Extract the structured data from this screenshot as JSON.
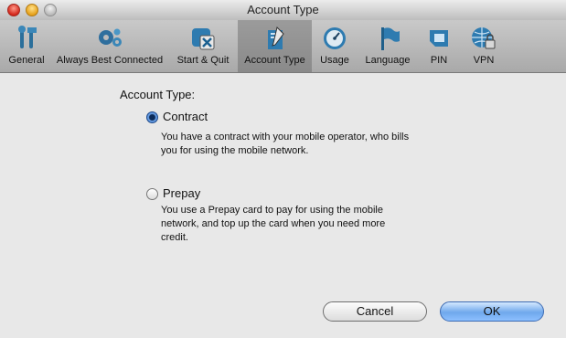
{
  "window": {
    "title": "Account Type"
  },
  "toolbar": {
    "items": [
      {
        "label": "General",
        "icon": "general-icon",
        "selected": false
      },
      {
        "label": "Always Best Connected",
        "icon": "gears-icon",
        "selected": false
      },
      {
        "label": "Start & Quit",
        "icon": "start-quit-icon",
        "selected": false
      },
      {
        "label": "Account Type",
        "icon": "account-type-icon",
        "selected": true
      },
      {
        "label": "Usage",
        "icon": "usage-gauge-icon",
        "selected": false
      },
      {
        "label": "Language",
        "icon": "flag-icon",
        "selected": false
      },
      {
        "label": "PIN",
        "icon": "sim-card-icon",
        "selected": false
      },
      {
        "label": "VPN",
        "icon": "vpn-globe-lock-icon",
        "selected": false
      }
    ]
  },
  "content": {
    "section_label": "Account Type:",
    "options": [
      {
        "label": "Contract",
        "checked": true,
        "description_lines": [
          "You have a contract with your mobile operator, who bills",
          "you for using the mobile network."
        ]
      },
      {
        "label": "Prepay",
        "checked": false,
        "description_lines": [
          "You use a Prepay card to pay for using the mobile",
          "network, and top up the card when you need more",
          "credit."
        ]
      }
    ]
  },
  "buttons": {
    "cancel": "Cancel",
    "ok": "OK"
  },
  "colors": {
    "accent_blue": "#6fa8ec",
    "toolbar_selected": "#8f8f8f"
  }
}
